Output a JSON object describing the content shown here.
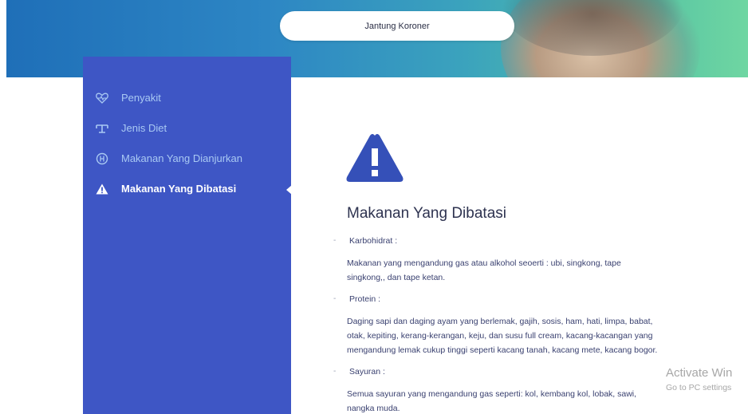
{
  "header": {
    "search_value": "Jantung Koroner"
  },
  "sidebar": {
    "items": [
      {
        "label": "Penyakit",
        "icon": "heartbeat-icon",
        "active": false
      },
      {
        "label": "Jenis Diet",
        "icon": "scale-icon",
        "active": false
      },
      {
        "label": "Makanan Yang Dianjurkan",
        "icon": "food-icon",
        "active": false
      },
      {
        "label": "Makanan Yang Dibatasi",
        "icon": "warning-icon",
        "active": true
      }
    ]
  },
  "main": {
    "title": "Makanan Yang Dibatasi",
    "sections": [
      {
        "bullet": "-",
        "heading": "Karbohidrat :",
        "lines": [
          "Makanan yang mengandung gas atau alkohol seoerti : ubi, singkong, tape",
          "singkong,, dan tape ketan."
        ]
      },
      {
        "bullet": "-",
        "heading": "Protein :",
        "lines": [
          "Daging sapi dan daging ayam yang berlemak, gajih, sosis, ham, hati, limpa, babat,",
          "otak, kepiting, kerang-kerangan, keju, dan susu full cream, kacang-kacangan yang",
          "mengandung lemak cukup tinggi seperti kacang tanah, kacang mete, kacang bogor."
        ]
      },
      {
        "bullet": "-",
        "heading": "Sayuran :",
        "lines": [
          "Semua sayuran yang mengandung gas seperti: kol, kembang kol, lobak, sawi,",
          "nangka muda."
        ]
      }
    ]
  },
  "watermark": {
    "line1": "Activate Win",
    "line2": "Go to PC settings"
  },
  "colors": {
    "sidebar": "#3e56c5",
    "accent": "#3550b8",
    "nav_text": "#a9c9f3"
  }
}
